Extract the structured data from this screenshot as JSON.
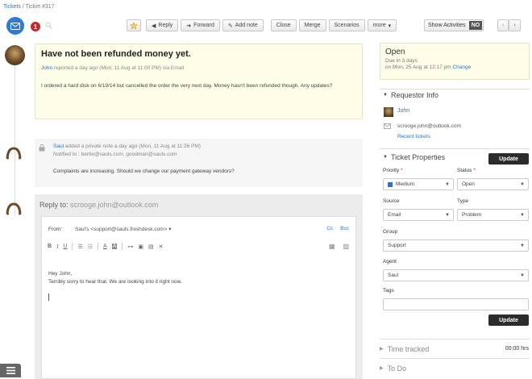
{
  "breadcrumb": {
    "root": "Tickets",
    "separator": " / ",
    "current": "Ticket #317"
  },
  "header": {
    "priority_badge": "1"
  },
  "toolbar": {
    "reply": "Reply",
    "forward": "Forward",
    "add_note": "Add note",
    "close": "Close",
    "merge": "Merge",
    "scenarios": "Scenarios",
    "more": "more",
    "show_activities": "Show Activities",
    "show_activities_state": "NO"
  },
  "message": {
    "title": "Have not been refunded money yet.",
    "author": "John",
    "meta": " reported a day ago (Mon, 11 Aug at 11:00 PM) via Email",
    "body": "I ordered a hard disk on 6/19/14 but cancelled the order the very next day. Money hasn't been refunded though. Any updates?"
  },
  "note": {
    "author": "Saul",
    "meta": " added a private note a day ago (Mon, 11 Aug at 11:36 PM)",
    "notified": "Notified to : bertie@sauls.com, goodman@sauls.com",
    "body": "Complaints are increasing. Should we change our payment gateway vendors?"
  },
  "reply": {
    "label": "Reply to:",
    "address": " scrooge.john@outlook.com",
    "from_label": "From:",
    "from_value": "Saul's <support@sauls.freshdesk.com>",
    "cc": "Cc",
    "bcc": "Bcc",
    "body_line1": "Hey John,",
    "body_line2": "Terribly sorry to hear that. We are looking into it right now."
  },
  "status": {
    "title": "Open",
    "due": "Due in 3 days",
    "date": "on Mon, 25 Aug at 12:17 pm",
    "change": "Change"
  },
  "requestor": {
    "heading": "Requestor Info",
    "name": "John",
    "email": "scrooge.john@outlook.com",
    "recent": "Recent tickets"
  },
  "properties": {
    "heading": "Ticket Properties",
    "update": "Update",
    "priority_label": "Priority",
    "priority_value": "Medium",
    "status_label": "Status",
    "status_value": "Open",
    "source_label": "Source",
    "source_value": "Email",
    "type_label": "Type",
    "type_value": "Problem",
    "group_label": "Group",
    "group_value": "Support",
    "agent_label": "Agent",
    "agent_value": "Saul",
    "tags_label": "Tags",
    "required_mark": "*"
  },
  "time_tracked": {
    "label": "Time tracked",
    "value": "00:00",
    "unit": "hrs"
  },
  "todo": {
    "label": "To Do"
  },
  "colors": {
    "accent": "#2e73c7",
    "badge": "#c8282c",
    "note_bg": "#fefee8"
  }
}
